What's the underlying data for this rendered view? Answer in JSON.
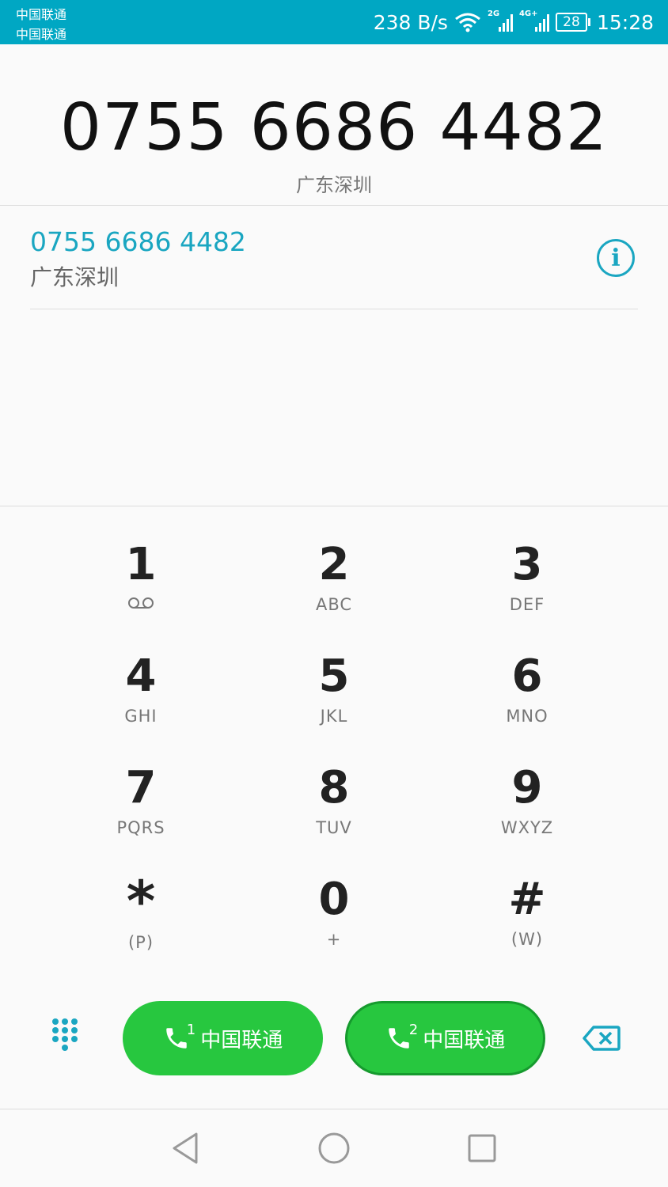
{
  "status_bar": {
    "carrier1": "中国联通",
    "carrier2": "中国联通",
    "net_speed": "238 B/s",
    "sim1_signal_tag": "2G",
    "sim2_signal_tag": "4G+",
    "battery": "28",
    "time": "15:28",
    "bg_color": "#00a7c3"
  },
  "dialer": {
    "number": "0755 6686 4482",
    "location": "广东深圳"
  },
  "suggestion": {
    "number": "0755 6686 4482",
    "location": "广东深圳",
    "info_icon": "info-icon"
  },
  "keys": [
    {
      "digit": "1",
      "letters": ""
    },
    {
      "digit": "2",
      "letters": "ABC"
    },
    {
      "digit": "3",
      "letters": "DEF"
    },
    {
      "digit": "4",
      "letters": "GHI"
    },
    {
      "digit": "5",
      "letters": "JKL"
    },
    {
      "digit": "6",
      "letters": "MNO"
    },
    {
      "digit": "7",
      "letters": "PQRS"
    },
    {
      "digit": "8",
      "letters": "TUV"
    },
    {
      "digit": "9",
      "letters": "WXYZ"
    },
    {
      "digit": "*",
      "letters": "(P)"
    },
    {
      "digit": "0",
      "letters": "+"
    },
    {
      "digit": "#",
      "letters": "(W)"
    }
  ],
  "actions": {
    "call_sim1_label": "中国联通",
    "call_sim1_index": "1",
    "call_sim2_label": "中国联通",
    "call_sim2_index": "2",
    "call_color": "#27c73f"
  }
}
